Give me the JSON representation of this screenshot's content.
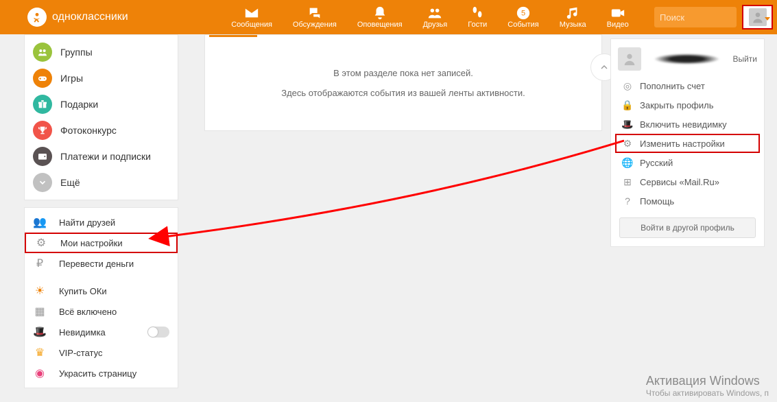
{
  "brand": "одноклассники",
  "nav": {
    "messages": "Сообщения",
    "discussions": "Обсуждения",
    "notifications": "Оповещения",
    "friends": "Друзья",
    "guests": "Гости",
    "events": "События",
    "music": "Музыка",
    "video": "Видео"
  },
  "search": {
    "placeholder": "Поиск"
  },
  "left_menu": {
    "groups": "Группы",
    "games": "Игры",
    "gifts": "Подарки",
    "photo_contest": "Фотоконкурс",
    "payments": "Платежи и подписки",
    "more": "Ещё"
  },
  "left_menu2": {
    "find_friends": "Найти друзей",
    "my_settings": "Мои настройки",
    "transfer": "Перевести деньги",
    "buy_ok": "Купить ОКи",
    "all_inclusive": "Всё включено",
    "invisible": "Невидимка",
    "vip": "VIP-статус",
    "decorate": "Украсить страницу"
  },
  "main": {
    "empty1": "В этом разделе пока нет записей.",
    "empty2": "Здесь отображаются события из вашей ленты активности."
  },
  "dropdown": {
    "exit": "Выйти",
    "topup": "Пополнить счет",
    "close_profile": "Закрыть профиль",
    "invisible": "Включить невидимку",
    "change_settings": "Изменить настройки",
    "language": "Русский",
    "services": "Сервисы «Mail.Ru»",
    "help": "Помощь",
    "login_other": "Войти в другой профиль"
  },
  "watermark": {
    "line1": "Активация Windows",
    "line2": "Чтобы активировать Windows, п"
  }
}
